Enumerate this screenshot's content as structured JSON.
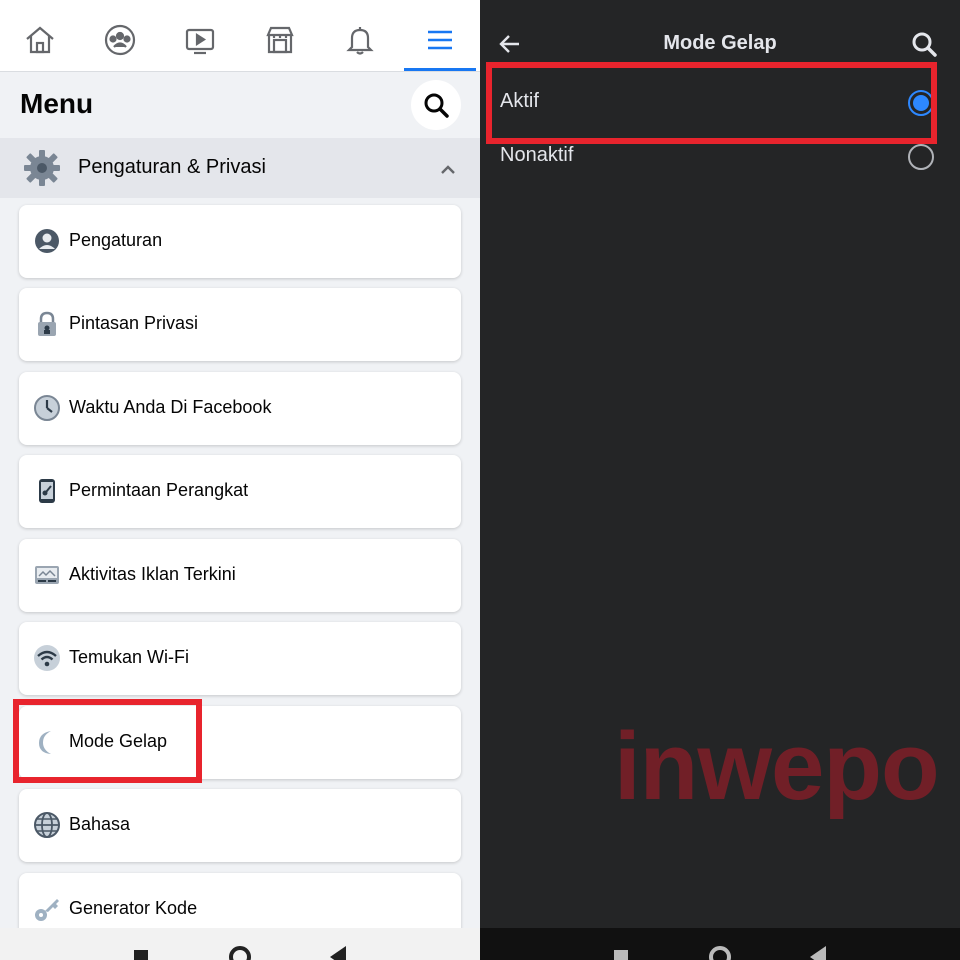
{
  "left": {
    "tabs": [
      {
        "name": "home-icon"
      },
      {
        "name": "groups-icon"
      },
      {
        "name": "watch-icon"
      },
      {
        "name": "marketplace-icon"
      },
      {
        "name": "notifications-icon"
      },
      {
        "name": "menu-icon",
        "active": true
      }
    ],
    "menu_title": "Menu",
    "section": {
      "label": "Pengaturan & Privasi",
      "icon": "gear-icon",
      "state": "expanded"
    },
    "items": [
      {
        "label": "Pengaturan",
        "icon": "account-icon"
      },
      {
        "label": "Pintasan Privasi",
        "icon": "lock-icon"
      },
      {
        "label": "Waktu Anda Di Facebook",
        "icon": "clock-icon"
      },
      {
        "label": "Permintaan Perangkat",
        "icon": "phone-key-icon"
      },
      {
        "label": "Aktivitas Iklan Terkini",
        "icon": "ad-activity-icon"
      },
      {
        "label": "Temukan Wi-Fi",
        "icon": "wifi-icon"
      },
      {
        "label": "Mode Gelap",
        "icon": "moon-icon",
        "highlighted": true
      },
      {
        "label": "Bahasa",
        "icon": "globe-icon"
      },
      {
        "label": "Generator Kode",
        "icon": "key-icon"
      }
    ]
  },
  "right": {
    "title": "Mode Gelap",
    "options": [
      {
        "label": "Aktif",
        "selected": true,
        "highlighted": true
      },
      {
        "label": "Nonaktif",
        "selected": false
      }
    ],
    "watermark": "inwepo"
  },
  "colors": {
    "accent": "#1877f2",
    "highlight": "#e8242d",
    "radio_selected": "#2d88ff",
    "dark_bg": "#242526",
    "watermark": "#7a1f28"
  }
}
